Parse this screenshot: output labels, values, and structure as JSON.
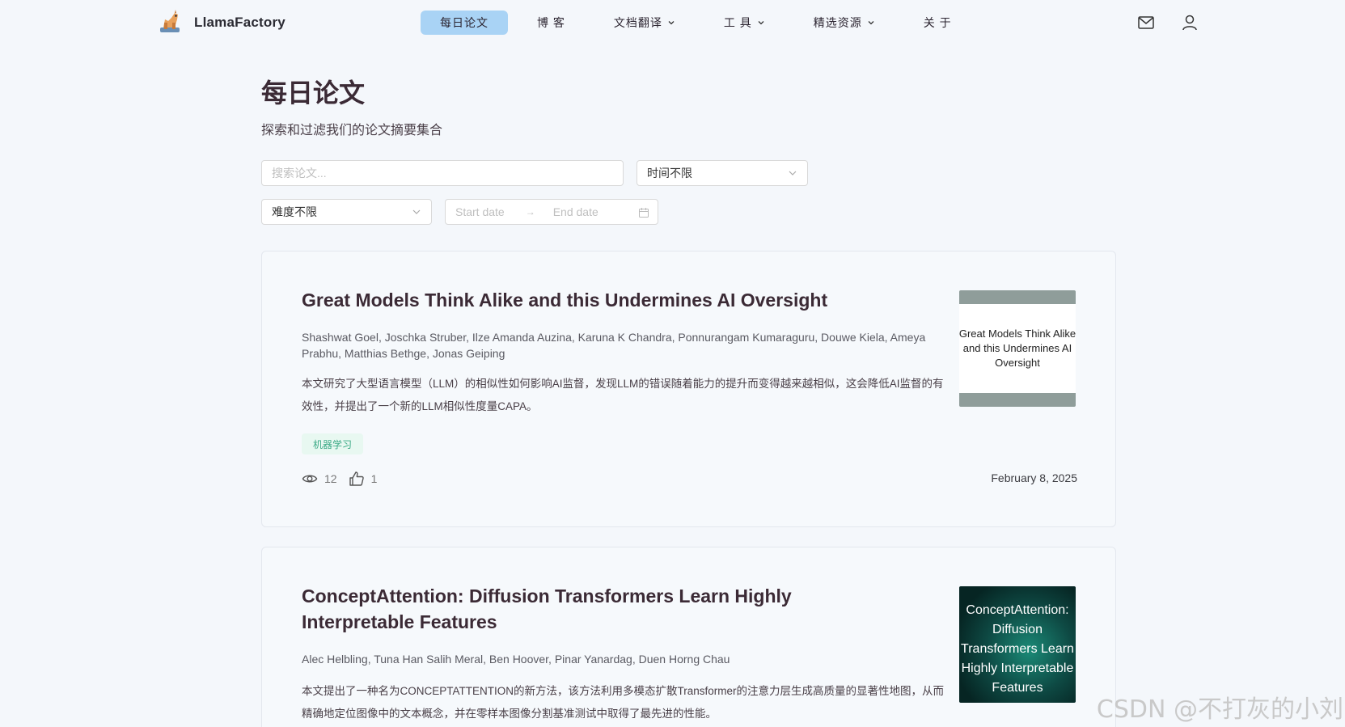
{
  "brand": {
    "name": "LlamaFactory"
  },
  "nav": {
    "items": [
      {
        "label": "每日论文",
        "active": true,
        "dropdown": false
      },
      {
        "label": "博 客",
        "active": false,
        "dropdown": false
      },
      {
        "label": "文档翻译",
        "active": false,
        "dropdown": true
      },
      {
        "label": "工 具",
        "active": false,
        "dropdown": true
      },
      {
        "label": "精选资源",
        "active": false,
        "dropdown": true
      },
      {
        "label": "关 于",
        "active": false,
        "dropdown": false
      }
    ],
    "icons": [
      "mail-icon",
      "user-icon"
    ]
  },
  "page": {
    "title": "每日论文",
    "subtitle": "探索和过滤我们的论文摘要集合"
  },
  "filters": {
    "search_placeholder": "搜索论文...",
    "time_value": "时间不限",
    "difficulty_value": "难度不限",
    "start_placeholder": "Start date",
    "end_placeholder": "End date"
  },
  "papers": [
    {
      "title": "Great Models Think Alike and this Undermines AI Oversight",
      "authors": "Shashwat Goel, Joschka Struber, Ilze Amanda Auzina, Karuna K Chandra, Ponnurangam Kumaraguru, Douwe Kiela, Ameya Prabhu, Matthias Bethge, Jonas Geiping",
      "summary": "本文研究了大型语言模型（LLM）的相似性如何影响AI监督，发现LLM的错误随着能力的提升而变得越来越相似，这会降低AI监督的有效性，并提出了一个新的LLM相似性度量CAPA。",
      "tag": "机器学习",
      "views": "12",
      "likes": "1",
      "date": "February 8, 2025",
      "thumb_text": "Great Models Think Alike and this Undermines AI Oversight"
    },
    {
      "title": "ConceptAttention: Diffusion Transformers Learn Highly Interpretable Features",
      "authors": "Alec Helbling, Tuna Han Salih Meral, Ben Hoover, Pinar Yanardag, Duen Horng Chau",
      "summary": "本文提出了一种名为CONCEPTATTENTION的新方法，该方法利用多模态扩散Transformer的注意力层生成高质量的显著性地图，从而精确地定位图像中的文本概念，并在零样本图像分割基准测试中取得了最先进的性能。",
      "thumb_text": "ConceptAttention: Diffusion Transformers Learn Highly Interpretable Features"
    }
  ],
  "watermark": "CSDN @不打灰的小刘"
}
